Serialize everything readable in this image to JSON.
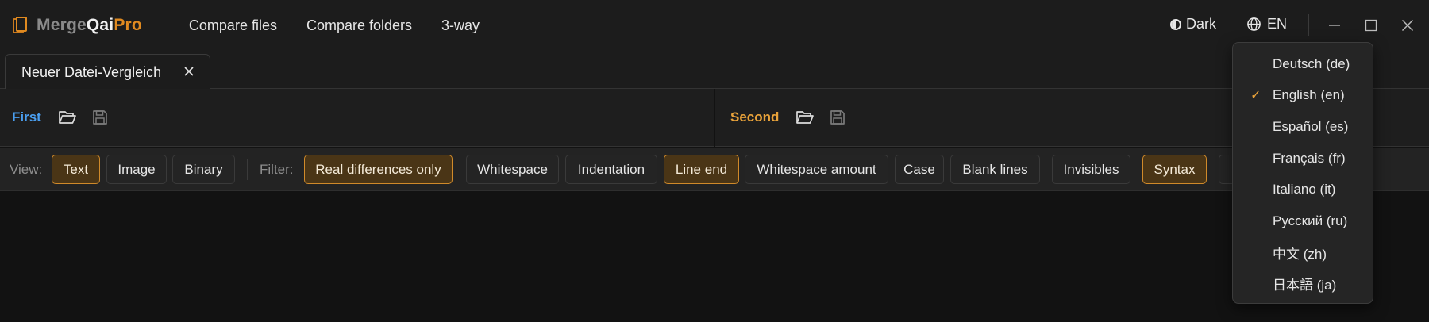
{
  "app": {
    "brand": {
      "part1": "Merge",
      "part2": "Qai",
      "part3": "Pro"
    },
    "nav": [
      "Compare files",
      "Compare folders",
      "3-way"
    ],
    "theme_label": "Dark",
    "lang_label": "EN"
  },
  "tabs": [
    {
      "label": "Neuer Datei-Vergleich"
    }
  ],
  "panes": {
    "left_title": "First",
    "right_title": "Second"
  },
  "options": {
    "view_label": "View:",
    "view_modes": [
      {
        "label": "Text",
        "active": true
      },
      {
        "label": "Image",
        "active": false
      },
      {
        "label": "Binary",
        "active": false
      }
    ],
    "filter_label": "Filter:",
    "filters": [
      {
        "label": "Real differences only",
        "active": true
      },
      {
        "label": "Whitespace",
        "active": false
      },
      {
        "label": "Indentation",
        "active": false
      },
      {
        "label": "Line end",
        "active": true
      },
      {
        "label": "Whitespace amount",
        "active": false
      },
      {
        "label": "Case",
        "active": false
      },
      {
        "label": "Blank lines",
        "active": false
      },
      {
        "label": "Invisibles",
        "active": false
      },
      {
        "label": "Syntax",
        "active": true
      }
    ]
  },
  "language_menu": {
    "selected": "en",
    "items": [
      {
        "label": "Deutsch  (de)",
        "code": "de",
        "selected": false
      },
      {
        "label": "English  (en)",
        "code": "en",
        "selected": true
      },
      {
        "label": "Español  (es)",
        "code": "es",
        "selected": false
      },
      {
        "label": "Français  (fr)",
        "code": "fr",
        "selected": false
      },
      {
        "label": "Italiano  (it)",
        "code": "it",
        "selected": false
      },
      {
        "label": "Русский  (ru)",
        "code": "ru",
        "selected": false
      },
      {
        "label": "中文  (zh)",
        "code": "zh",
        "selected": false
      },
      {
        "label": "日本語  (ja)",
        "code": "ja",
        "selected": false
      }
    ],
    "check_glyph": "✓"
  },
  "colors": {
    "accent": "#e08a20",
    "first_pane": "#4a9eef",
    "second_pane": "#e8a23a",
    "active_chip_bg": "#4a3516",
    "active_chip_border": "#d08a2a"
  }
}
